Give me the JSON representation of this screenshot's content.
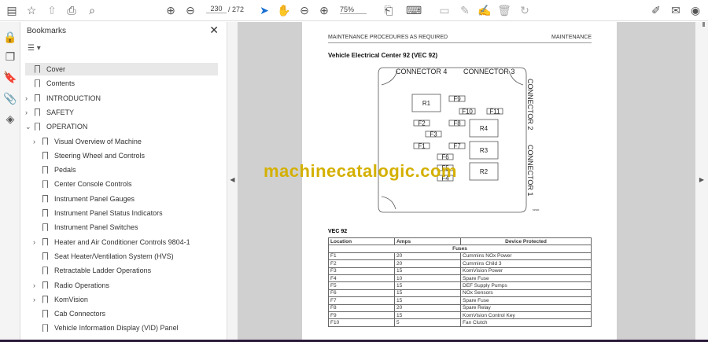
{
  "toolbar": {
    "page_current": "230",
    "page_total": "/ 272",
    "zoom": "75%"
  },
  "bookmarks": {
    "title": "Bookmarks",
    "close": "✕",
    "options": "☰ ▾",
    "items": [
      {
        "label": "Cover",
        "level": 0,
        "expand": false,
        "selected": true
      },
      {
        "label": "Contents",
        "level": 0,
        "expand": false
      },
      {
        "label": "INTRODUCTION",
        "level": 0,
        "expand": "›"
      },
      {
        "label": "SAFETY",
        "level": 0,
        "expand": "›"
      },
      {
        "label": "OPERATION",
        "level": 0,
        "expand": "⌄"
      },
      {
        "label": "Visual Overview of Machine",
        "level": 1,
        "expand": "›"
      },
      {
        "label": "Steering Wheel and Controls",
        "level": 1
      },
      {
        "label": "Pedals",
        "level": 1
      },
      {
        "label": "Center Console Controls",
        "level": 1
      },
      {
        "label": "Instrument Panel Gauges",
        "level": 1
      },
      {
        "label": "Instrument Panel Status Indicators",
        "level": 1
      },
      {
        "label": "Instrument Panel Switches",
        "level": 1
      },
      {
        "label": "Heater and Air Conditioner Controls 9804-1",
        "level": 1,
        "expand": "›"
      },
      {
        "label": "Seat Heater/Ventilation System (HVS)",
        "level": 1
      },
      {
        "label": "Retractable Ladder Operations",
        "level": 1
      },
      {
        "label": "Radio Operations",
        "level": 1,
        "expand": "›"
      },
      {
        "label": "KomVision",
        "level": 1,
        "expand": "›"
      },
      {
        "label": "Cab Connectors",
        "level": 1
      },
      {
        "label": "Vehicle Information Display (VID) Panel",
        "level": 1
      }
    ]
  },
  "document": {
    "header_left": "MAINTENANCE PROCEDURES AS REQUIRED",
    "header_right": "MAINTENANCE",
    "title": "Vehicle Electrical Center 92 (VEC 92)",
    "diagram": {
      "connector4": "CONNECTOR  4",
      "connector3": "CONNECTOR  3",
      "connector2": "CONNECTOR  2",
      "connector1": "CONNECTOR  1",
      "relays": [
        "R1",
        "R4",
        "R3",
        "R2"
      ],
      "fuses": [
        "F9",
        "F10",
        "F11",
        "F2",
        "F8",
        "F3",
        "F1",
        "F7",
        "F6",
        "F5",
        "F4"
      ],
      "fig": "61520"
    },
    "table_title": "VEC 92",
    "table_headers": [
      "Location",
      "Amps",
      "Device Protected"
    ],
    "section": "Fuses",
    "rows": [
      [
        "F1",
        "20",
        "Cummins NOx Power"
      ],
      [
        "F2",
        "20",
        "Cummins Child 3"
      ],
      [
        "F3",
        "15",
        "KomVision Power"
      ],
      [
        "F4",
        "10",
        "Spare Fuse"
      ],
      [
        "F5",
        "15",
        "DEF Supply Pumps"
      ],
      [
        "F6",
        "15",
        "NOx Sensors"
      ],
      [
        "F7",
        "15",
        "Spare Fuse"
      ],
      [
        "F8",
        "20",
        "Spare Relay"
      ],
      [
        "F9",
        "15",
        "KomVision Control Key"
      ],
      [
        "F10",
        "5",
        "Fan Clutch"
      ]
    ]
  },
  "watermark": "machinecatalogic.com"
}
